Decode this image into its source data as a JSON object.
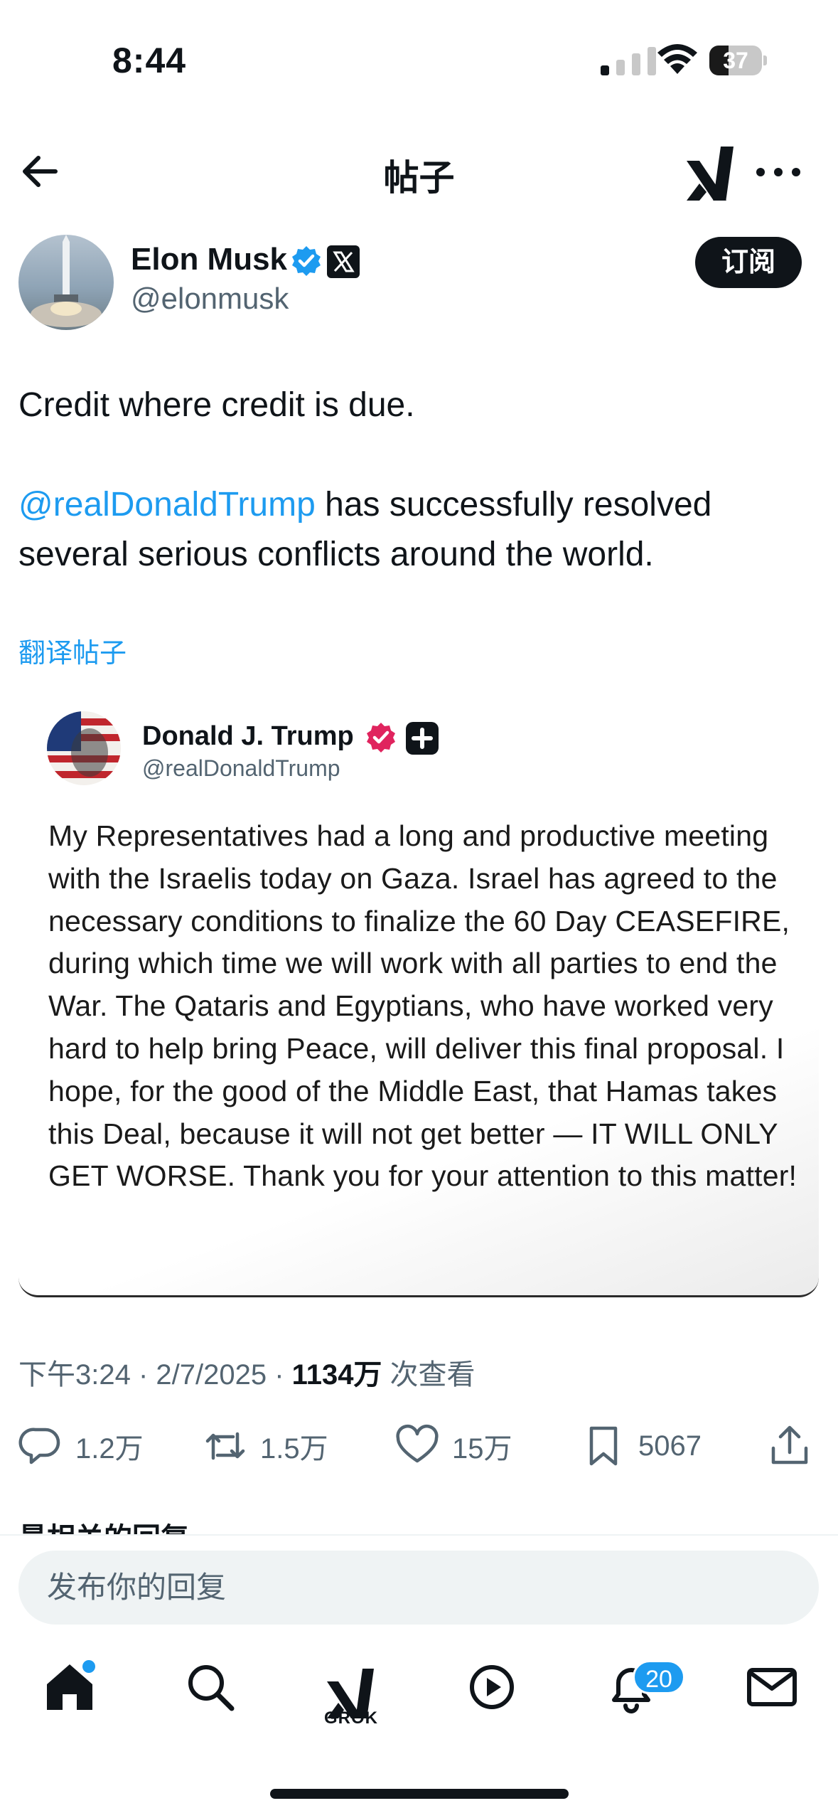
{
  "status_bar": {
    "time": "8:44",
    "battery": "37",
    "battery_level": 0.37
  },
  "header": {
    "title": "帖子"
  },
  "author": {
    "name": "Elon Musk",
    "handle": "@elonmusk",
    "subscribe_label": "订阅"
  },
  "tweet": {
    "line1": "Credit where credit is due.",
    "mention": "@realDonaldTrump",
    "line2_rest": " has successfully resolved several serious conflicts around the world.",
    "translate_label": "翻译帖子"
  },
  "embedded_post": {
    "name": "Donald J. Trump",
    "handle": "@realDonaldTrump",
    "text": "My Representatives had a long and productive meeting with the Israelis today on Gaza. Israel has agreed to the necessary conditions to finalize the 60 Day CEASEFIRE, during which time we will work with all parties to end the War. The Qataris and Egyptians, who have worked very hard to help bring Peace, will deliver this final proposal. I hope, for the good of the Middle East, that Hamas takes this Deal, because it will not get better — IT WILL ONLY GET WORSE. Thank you for your attention to this matter!"
  },
  "meta": {
    "time": "下午3:24",
    "date": "2/7/2025",
    "views_count": "1134万",
    "views_label": " 次查看"
  },
  "actions": {
    "replies": "1.2万",
    "reposts": "1.5万",
    "likes": "15万",
    "bookmarks": "5067"
  },
  "replies_section": {
    "sort_label": "最相关的回复 ⌄"
  },
  "reply_box": {
    "placeholder": "发布你的回复"
  },
  "bottom_nav": {
    "notifications_badge": "20",
    "grok_label": "GROK"
  },
  "colors": {
    "accent": "#1d9bf0",
    "text": "#0f1419",
    "secondary": "#536471",
    "trump_badge": "#e0245e"
  }
}
